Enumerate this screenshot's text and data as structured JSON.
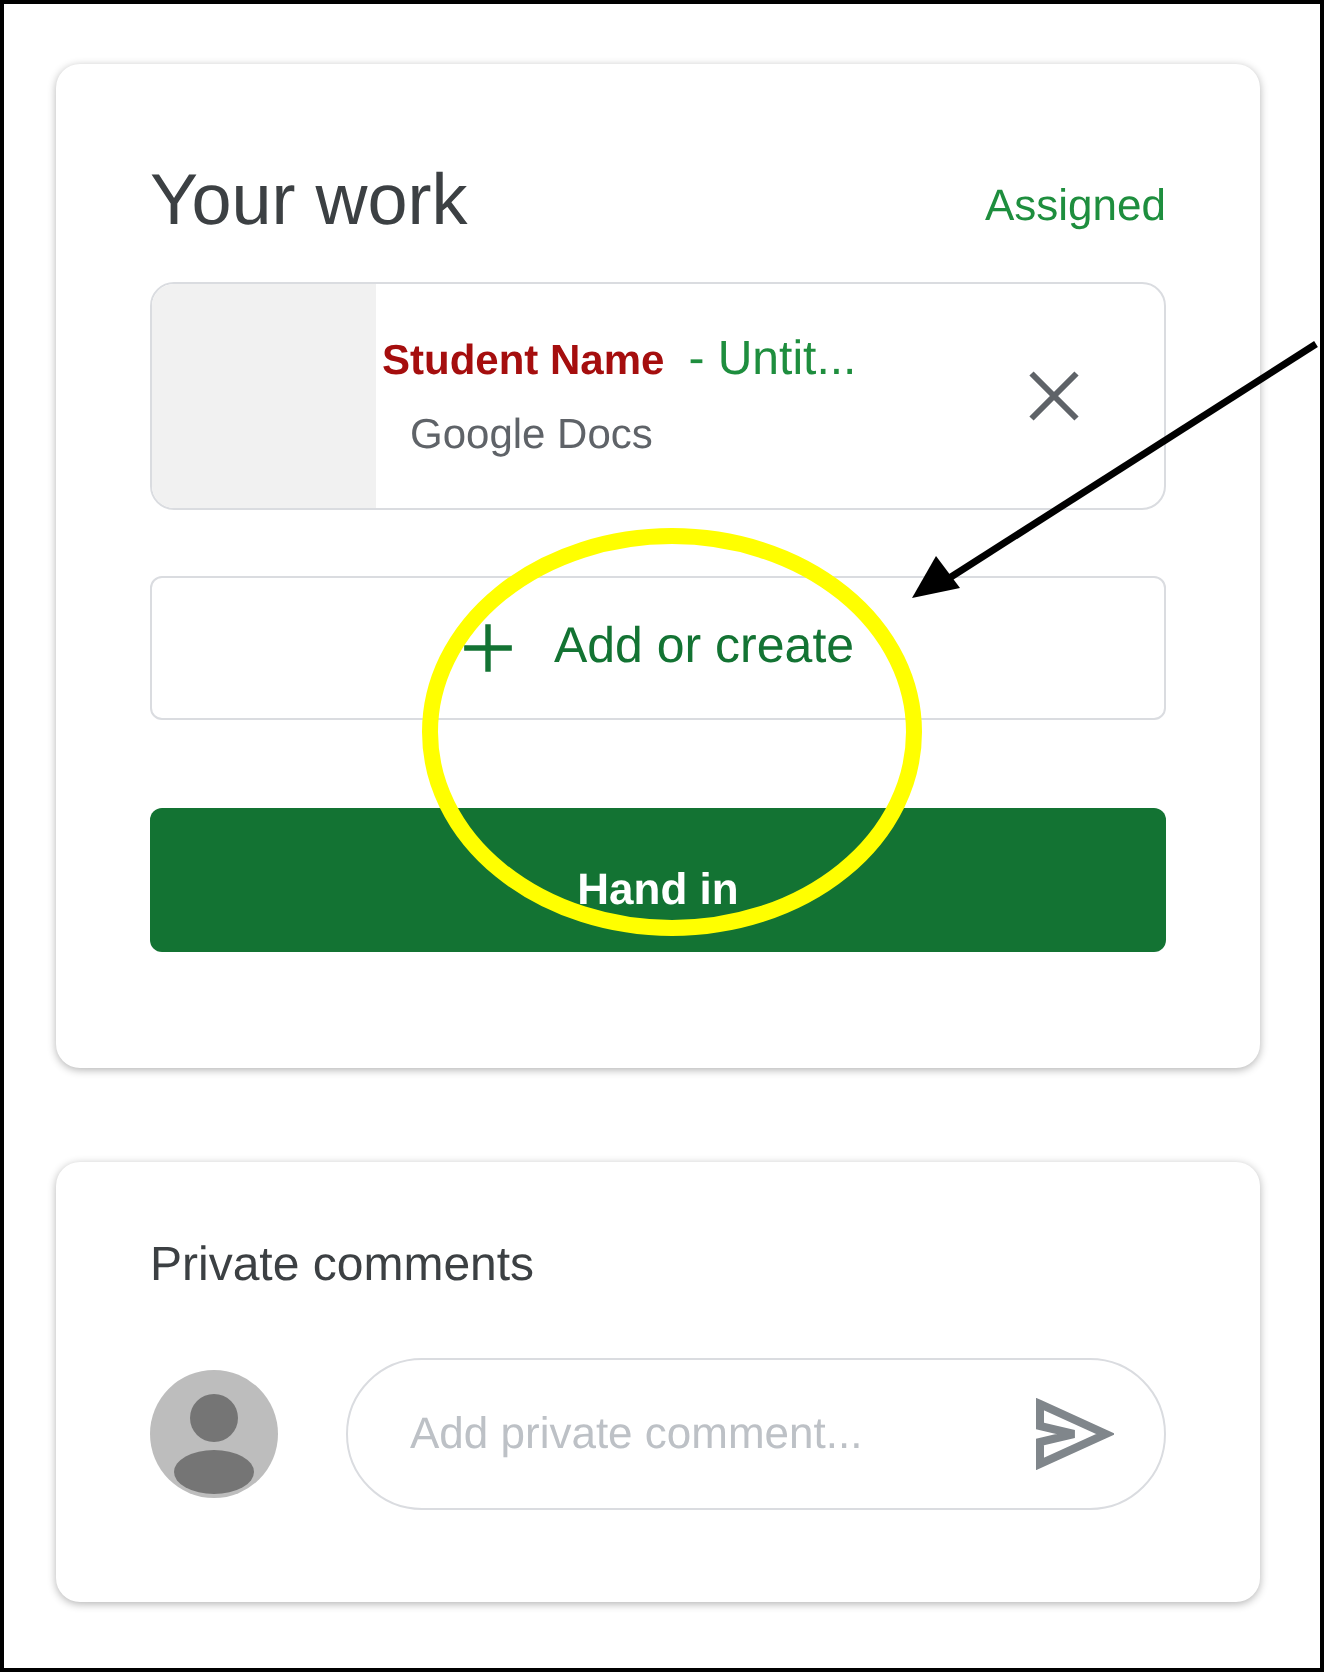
{
  "work_card": {
    "title": "Your work",
    "status": "Assigned",
    "attachment": {
      "name": "Student Name",
      "title_rest": "- Untit...",
      "type": "Google Docs"
    },
    "add_button": "Add or create",
    "submit_button": "Hand in"
  },
  "comments_card": {
    "title": "Private comments",
    "placeholder": "Add private comment..."
  }
}
